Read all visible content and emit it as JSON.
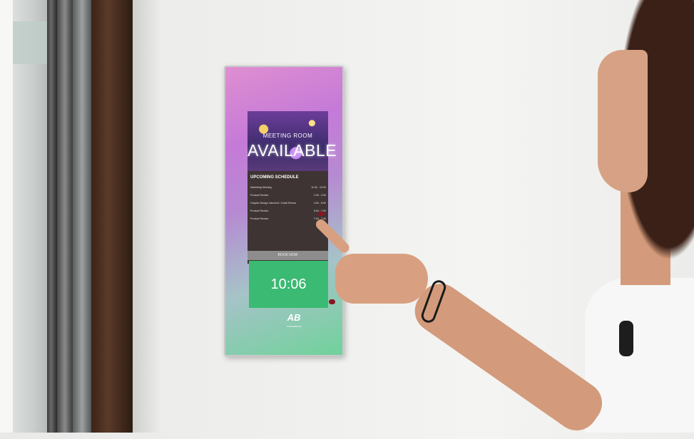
{
  "device": {
    "hero_subtitle": "MEETING ROOM",
    "hero_status": "AVAILABLE",
    "schedule": {
      "heading": "UPCOMING SCHEDULE",
      "items": [
        {
          "title": "Marketing Meeting",
          "time": "11:00 - 12:00"
        },
        {
          "title": "Product Review",
          "time": "1:00 - 2:00"
        },
        {
          "title": "Graphic Design Intervent / Collat Renew",
          "time": "4:00 - 5:00"
        },
        {
          "title": "Product Review",
          "time": "5:00 - 7:00"
        },
        {
          "title": "Product Review",
          "time": "7:00 - 7:30"
        }
      ]
    },
    "action_bar": "BOOK NOW",
    "clock": "10:06",
    "logo": "AB",
    "logo_sub": "CONFERENCE"
  },
  "colors": {
    "clock_bg": "#3aba72",
    "frame_top": "#e08fd0",
    "frame_bottom": "#6fd29a"
  }
}
